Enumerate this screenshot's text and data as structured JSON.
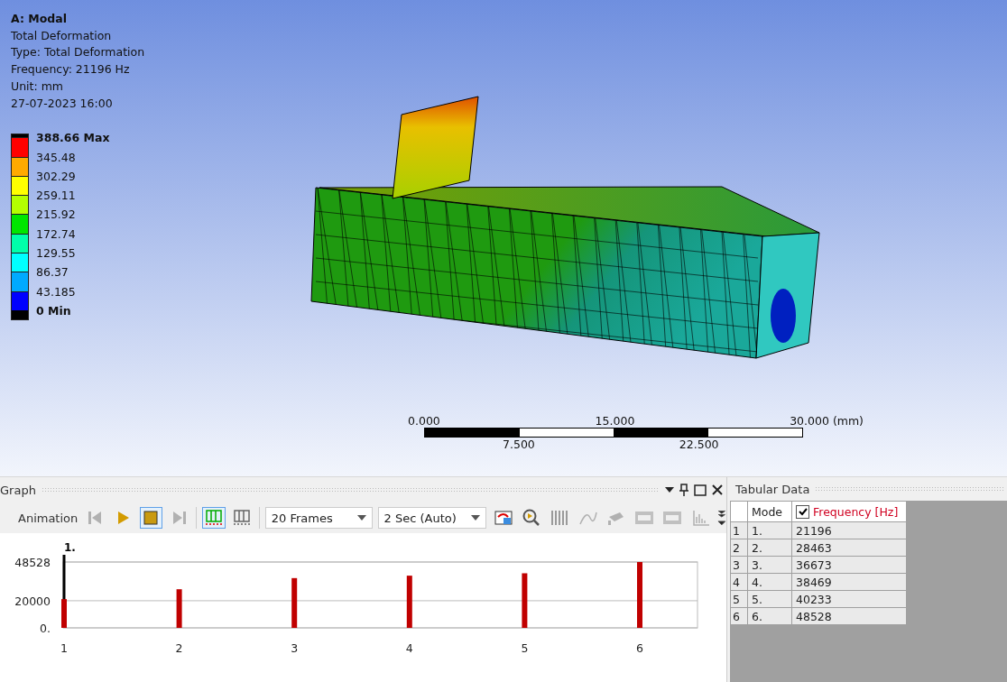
{
  "viewport": {
    "header": {
      "title": "A: Modal",
      "lines": [
        "Total Deformation",
        "Type: Total Deformation",
        "Frequency: 21196 Hz",
        "Unit: mm",
        "27-07-2023 16:00"
      ]
    },
    "legend": {
      "labels": [
        "388.66 Max",
        "345.48",
        "302.29",
        "259.11",
        "215.92",
        "172.74",
        "129.55",
        "86.37",
        "43.185",
        "0 Min"
      ],
      "bands": [
        {
          "color": "#ff0000"
        },
        {
          "color": "#ffaa00"
        },
        {
          "color": "#ffff00"
        },
        {
          "color": "#b4ff00"
        },
        {
          "color": "#00e600"
        },
        {
          "color": "#00ffaa"
        },
        {
          "color": "#00ffff"
        },
        {
          "color": "#00aaff"
        },
        {
          "color": "#0000ff"
        }
      ]
    },
    "scale_bar": {
      "top_labels": [
        "0.000",
        "15.000",
        "30.000 (mm)"
      ],
      "bottom_labels": [
        "7.500",
        "22.500"
      ]
    }
  },
  "graph": {
    "title": "Graph",
    "toolbar_label": "Animation",
    "buttons": [
      {
        "kind": "first",
        "selected": false,
        "disabled": true
      },
      {
        "kind": "play",
        "selected": false,
        "disabled": false
      },
      {
        "kind": "stop",
        "selected": true,
        "disabled": false
      },
      {
        "kind": "last",
        "selected": false,
        "disabled": true
      },
      {
        "kind": "bars",
        "selected": true,
        "disabled": false
      },
      {
        "kind": "bars",
        "selected": false,
        "disabled": true
      }
    ],
    "frames": "20 Frames",
    "duration": "2 Sec (Auto)",
    "tools": [
      {
        "kind": "video",
        "disabled": false
      },
      {
        "kind": "zoom",
        "disabled": false
      },
      {
        "kind": "grid",
        "disabled": true
      },
      {
        "kind": "curve",
        "disabled": true
      },
      {
        "kind": "camera",
        "disabled": true
      },
      {
        "kind": "film",
        "disabled": true
      },
      {
        "kind": "film",
        "disabled": true
      },
      {
        "kind": "plot",
        "disabled": true
      }
    ],
    "chart_data": {
      "type": "bar",
      "categories": [
        "1",
        "2",
        "3",
        "4",
        "5",
        "6"
      ],
      "series": [
        {
          "color": "#c00000",
          "values": [
            21196,
            28463,
            36673,
            38469,
            40233,
            48528
          ]
        }
      ],
      "ylim": [
        0,
        48528
      ],
      "yticks": [
        {
          "value": 0,
          "label": "0."
        },
        20000,
        48528
      ],
      "annotations": [
        "1."
      ]
    }
  },
  "tabular_data": {
    "title": "Tabular Data",
    "columns": [
      {
        "label": "Mode"
      },
      {
        "label": "Frequency [Hz]",
        "checked": true
      }
    ],
    "rows": [
      {
        "index": "1",
        "mode": "1.",
        "frequency": "21196"
      },
      {
        "index": "2",
        "mode": "2.",
        "frequency": "28463"
      },
      {
        "index": "3",
        "mode": "3.",
        "frequency": "36673"
      },
      {
        "index": "4",
        "mode": "4.",
        "frequency": "38469"
      },
      {
        "index": "5",
        "mode": "5.",
        "frequency": "40233"
      },
      {
        "index": "6",
        "mode": "6.",
        "frequency": "48528"
      }
    ]
  }
}
